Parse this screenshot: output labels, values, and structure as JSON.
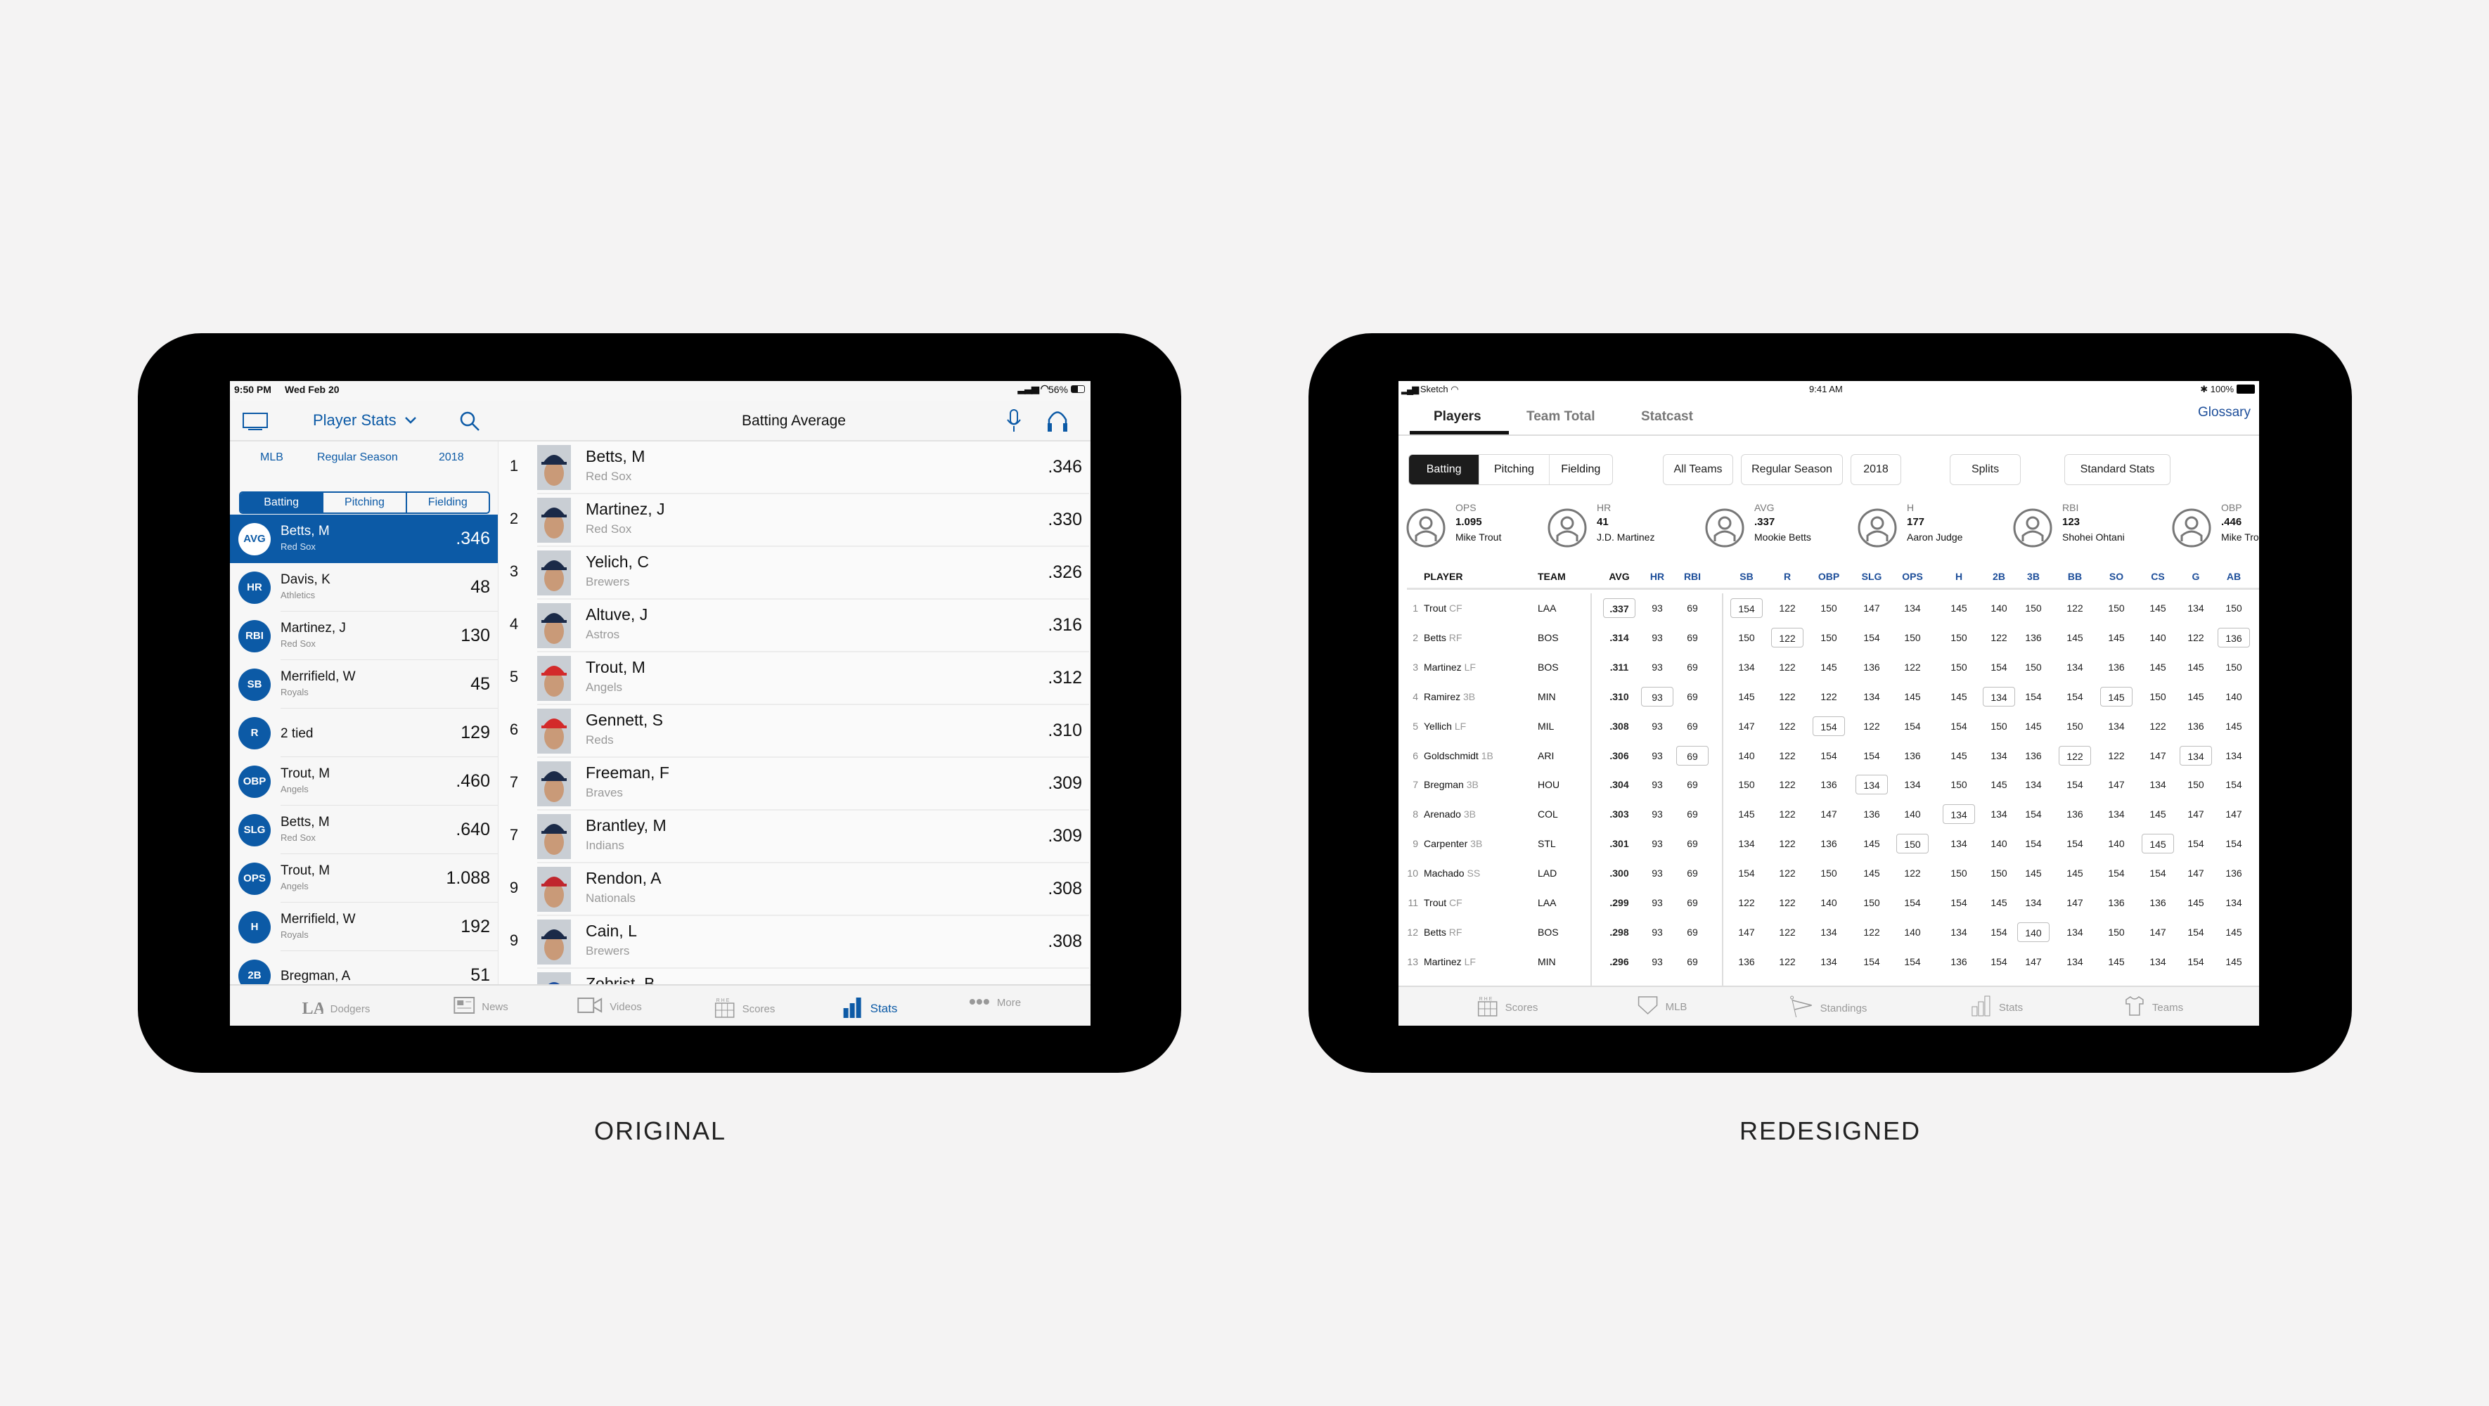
{
  "captions": {
    "original": "ORIGINAL",
    "redesigned": "REDESIGNED"
  },
  "colors": {
    "original_accent": "#0c5aa6",
    "redesign_accent": "#1d4e9a",
    "redesign_selected": "#1c1c1c",
    "background": "#f4f3f3"
  },
  "original": {
    "status": {
      "time": "9:50 PM",
      "date": "Wed Feb 20",
      "battery": "56%"
    },
    "header": {
      "title": "Player Stats",
      "main_title": "Batting Average",
      "icons": [
        "tv-icon",
        "chevron-down-icon",
        "search-icon",
        "microphone-icon",
        "headphones-icon"
      ]
    },
    "filters": {
      "league": "MLB",
      "season_type": "Regular Season",
      "year": "2018"
    },
    "segments": [
      "Batting",
      "Pitching",
      "Fielding"
    ],
    "selected_segment": "Batting",
    "categories": [
      {
        "stat": "AVG",
        "name": "Betts, M",
        "team": "Red Sox",
        "value": ".346",
        "selected": true
      },
      {
        "stat": "HR",
        "name": "Davis, K",
        "team": "Athletics",
        "value": "48"
      },
      {
        "stat": "RBI",
        "name": "Martinez, J",
        "team": "Red Sox",
        "value": "130"
      },
      {
        "stat": "SB",
        "name": "Merrifield, W",
        "team": "Royals",
        "value": "45"
      },
      {
        "stat": "R",
        "name": "2 tied",
        "team": "",
        "value": "129"
      },
      {
        "stat": "OBP",
        "name": "Trout, M",
        "team": "Angels",
        "value": ".460"
      },
      {
        "stat": "SLG",
        "name": "Betts, M",
        "team": "Red Sox",
        "value": ".640"
      },
      {
        "stat": "OPS",
        "name": "Trout, M",
        "team": "Angels",
        "value": "1.088"
      },
      {
        "stat": "H",
        "name": "Merrifield, W",
        "team": "Royals",
        "value": "192"
      },
      {
        "stat": "2B",
        "name": "Bregman, A",
        "team": "",
        "value": "51"
      }
    ],
    "leaders": [
      {
        "rank": "1",
        "name": "Betts, M",
        "team": "Red Sox",
        "value": ".346",
        "cap": "#1b2a48"
      },
      {
        "rank": "2",
        "name": "Martinez, J",
        "team": "Red Sox",
        "value": ".330",
        "cap": "#1b2a48"
      },
      {
        "rank": "3",
        "name": "Yelich, C",
        "team": "Brewers",
        "value": ".326",
        "cap": "#1b2a48"
      },
      {
        "rank": "4",
        "name": "Altuve, J",
        "team": "Astros",
        "value": ".316",
        "cap": "#1b2a48"
      },
      {
        "rank": "5",
        "name": "Trout, M",
        "team": "Angels",
        "value": ".312",
        "cap": "#d32a2a"
      },
      {
        "rank": "6",
        "name": "Gennett, S",
        "team": "Reds",
        "value": ".310",
        "cap": "#d32a2a"
      },
      {
        "rank": "7",
        "name": "Freeman, F",
        "team": "Braves",
        "value": ".309",
        "cap": "#1b2a48"
      },
      {
        "rank": "7",
        "name": "Brantley, M",
        "team": "Indians",
        "value": ".309",
        "cap": "#1b2a48"
      },
      {
        "rank": "9",
        "name": "Rendon, A",
        "team": "Nationals",
        "value": ".308",
        "cap": "#c0262d"
      },
      {
        "rank": "9",
        "name": "Cain, L",
        "team": "Brewers",
        "value": ".308",
        "cap": "#1b2a48"
      },
      {
        "rank": "",
        "name": "Zobrist, B",
        "team": "",
        "value": "",
        "cap": "#1e4fa0"
      }
    ],
    "tabbar": [
      {
        "label": "Dodgers",
        "icon": "la-logo-icon"
      },
      {
        "label": "News",
        "icon": "newspaper-icon"
      },
      {
        "label": "Videos",
        "icon": "video-camera-icon"
      },
      {
        "label": "Scores",
        "icon": "scoreboard-icon"
      },
      {
        "label": "Stats",
        "icon": "bar-chart-icon",
        "active": true
      },
      {
        "label": "More",
        "icon": "more-dots-icon"
      }
    ]
  },
  "redesigned": {
    "status": {
      "carrier": "Sketch",
      "time": "9:41 AM",
      "battery": "100%"
    },
    "tabs": [
      {
        "label": "Players",
        "active": true
      },
      {
        "label": "Team Total"
      },
      {
        "label": "Statcast"
      }
    ],
    "glossary": "Glossary",
    "segments": [
      "Batting",
      "Pitching",
      "Fielding"
    ],
    "selected_segment": "Batting",
    "filters": {
      "teams": "All Teams",
      "season_type": "Regular Season",
      "year": "2018",
      "splits": "Splits",
      "stats_type": "Standard Stats"
    },
    "leaders": [
      {
        "stat": "OPS",
        "value": "1.095",
        "player": "Mike Trout"
      },
      {
        "stat": "HR",
        "value": "41",
        "player": "J.D. Martinez"
      },
      {
        "stat": "AVG",
        "value": ".337",
        "player": "Mookie Betts"
      },
      {
        "stat": "H",
        "value": "177",
        "player": "Aaron Judge"
      },
      {
        "stat": "RBI",
        "value": "123",
        "player": "Shohei Ohtani"
      },
      {
        "stat": "OBP",
        "value": ".446",
        "player": "Mike Trout"
      }
    ],
    "table": {
      "player_header": "PLAYER",
      "team_header": "TEAM",
      "stat_columns": [
        "AVG",
        "HR",
        "RBI",
        "SB",
        "R",
        "OBP",
        "SLG",
        "OPS",
        "H",
        "2B",
        "3B",
        "BB",
        "SO",
        "CS",
        "G",
        "AB"
      ],
      "rows": [
        {
          "rank": "1",
          "name": "Trout",
          "pos": "CF",
          "team": "LAA",
          "stats": [
            ".337",
            "93",
            "69",
            "154",
            "122",
            "150",
            "147",
            "134",
            "145",
            "140",
            "150",
            "122",
            "150",
            "145",
            "134",
            "150"
          ],
          "highlight": [
            "AVG",
            "SB"
          ]
        },
        {
          "rank": "2",
          "name": "Betts",
          "pos": "RF",
          "team": "BOS",
          "stats": [
            ".314",
            "93",
            "69",
            "150",
            "122",
            "150",
            "154",
            "150",
            "150",
            "122",
            "136",
            "145",
            "145",
            "140",
            "122",
            "136"
          ],
          "highlight": [
            "R",
            "AB"
          ]
        },
        {
          "rank": "3",
          "name": "Martinez",
          "pos": "LF",
          "team": "BOS",
          "stats": [
            ".311",
            "93",
            "69",
            "134",
            "122",
            "145",
            "136",
            "122",
            "150",
            "154",
            "150",
            "134",
            "136",
            "145",
            "145",
            "150"
          ],
          "highlight": []
        },
        {
          "rank": "4",
          "name": "Ramirez",
          "pos": "3B",
          "team": "MIN",
          "stats": [
            ".310",
            "93",
            "69",
            "145",
            "122",
            "122",
            "134",
            "145",
            "145",
            "134",
            "154",
            "154",
            "145",
            "150",
            "145",
            "140"
          ],
          "highlight": [
            "HR",
            "2B",
            "SO"
          ]
        },
        {
          "rank": "5",
          "name": "Yellich",
          "pos": "LF",
          "team": "MIL",
          "stats": [
            ".308",
            "93",
            "69",
            "147",
            "122",
            "154",
            "122",
            "154",
            "154",
            "150",
            "145",
            "150",
            "134",
            "122",
            "136",
            "145"
          ],
          "highlight": [
            "OBP"
          ]
        },
        {
          "rank": "6",
          "name": "Goldschmidt",
          "pos": "1B",
          "team": "ARI",
          "stats": [
            ".306",
            "93",
            "69",
            "140",
            "122",
            "154",
            "154",
            "136",
            "145",
            "134",
            "136",
            "122",
            "122",
            "147",
            "134",
            "134"
          ],
          "highlight": [
            "RBI",
            "BB",
            "G"
          ]
        },
        {
          "rank": "7",
          "name": "Bregman",
          "pos": "3B",
          "team": "HOU",
          "stats": [
            ".304",
            "93",
            "69",
            "150",
            "122",
            "136",
            "134",
            "134",
            "150",
            "145",
            "134",
            "154",
            "147",
            "134",
            "150",
            "154"
          ],
          "highlight": [
            "SLG"
          ]
        },
        {
          "rank": "8",
          "name": "Arenado",
          "pos": "3B",
          "team": "COL",
          "stats": [
            ".303",
            "93",
            "69",
            "145",
            "122",
            "147",
            "136",
            "140",
            "134",
            "134",
            "154",
            "136",
            "134",
            "145",
            "147",
            "147"
          ],
          "highlight": [
            "H"
          ]
        },
        {
          "rank": "9",
          "name": "Carpenter",
          "pos": "3B",
          "team": "STL",
          "stats": [
            ".301",
            "93",
            "69",
            "134",
            "122",
            "136",
            "145",
            "150",
            "134",
            "140",
            "154",
            "154",
            "140",
            "145",
            "154",
            "154"
          ],
          "highlight": [
            "OPS",
            "CS"
          ]
        },
        {
          "rank": "10",
          "name": "Machado",
          "pos": "SS",
          "team": "LAD",
          "stats": [
            ".300",
            "93",
            "69",
            "154",
            "122",
            "150",
            "145",
            "122",
            "150",
            "150",
            "145",
            "145",
            "154",
            "154",
            "147",
            "136"
          ],
          "highlight": []
        },
        {
          "rank": "11",
          "name": "Trout",
          "pos": "CF",
          "team": "LAA",
          "stats": [
            ".299",
            "93",
            "69",
            "122",
            "122",
            "140",
            "150",
            "154",
            "154",
            "145",
            "134",
            "147",
            "136",
            "136",
            "145",
            "134"
          ],
          "highlight": []
        },
        {
          "rank": "12",
          "name": "Betts",
          "pos": "RF",
          "team": "BOS",
          "stats": [
            ".298",
            "93",
            "69",
            "147",
            "122",
            "134",
            "122",
            "140",
            "134",
            "154",
            "140",
            "134",
            "150",
            "147",
            "154",
            "145"
          ],
          "highlight": [
            "3B"
          ]
        },
        {
          "rank": "13",
          "name": "Martinez",
          "pos": "LF",
          "team": "MIN",
          "stats": [
            ".296",
            "93",
            "69",
            "136",
            "122",
            "134",
            "154",
            "154",
            "136",
            "154",
            "147",
            "134",
            "145",
            "134",
            "154",
            "145"
          ],
          "highlight": []
        }
      ]
    },
    "tabbar": [
      {
        "label": "Scores",
        "icon": "scoreboard-icon"
      },
      {
        "label": "MLB",
        "icon": "home-plate-icon"
      },
      {
        "label": "Standings",
        "icon": "pennant-flag-icon"
      },
      {
        "label": "Stats",
        "icon": "bar-chart-icon"
      },
      {
        "label": "Teams",
        "icon": "jersey-icon"
      }
    ]
  }
}
